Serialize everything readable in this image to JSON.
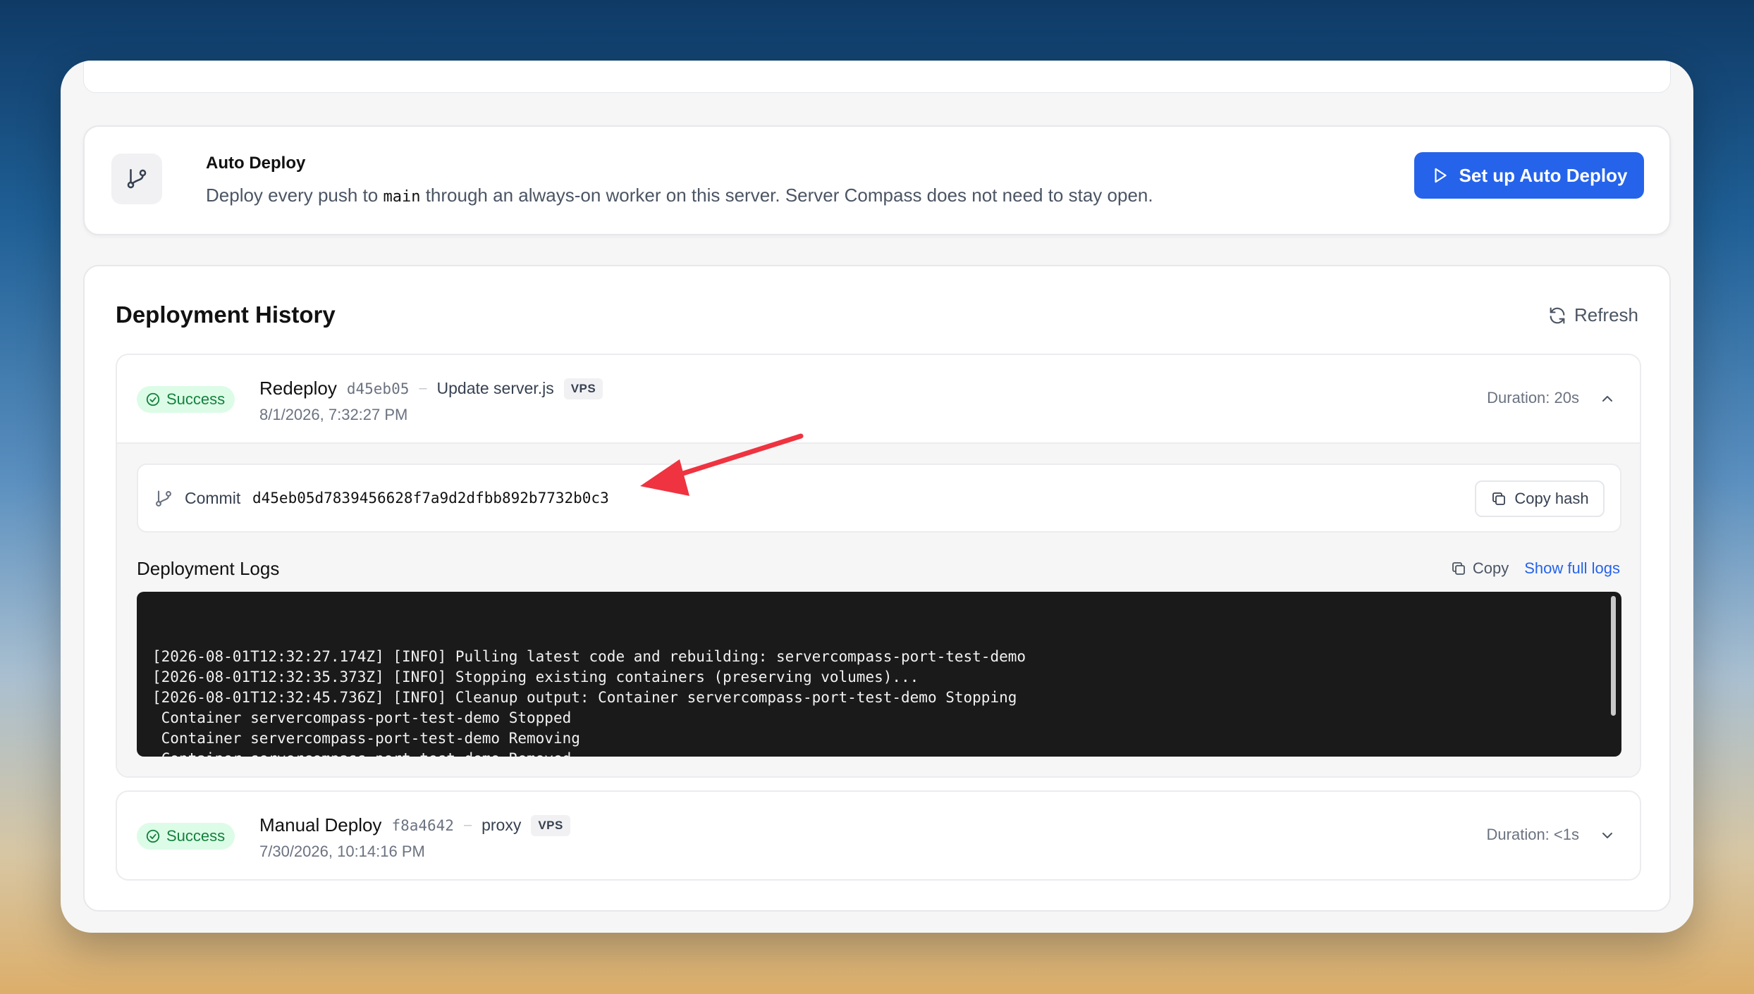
{
  "auto_deploy": {
    "title": "Auto Deploy",
    "desc_prefix": "Deploy every push to",
    "branch": "main",
    "desc_suffix": "through an always-on worker on this server. Server Compass does not need to stay open.",
    "button_label": "Set up Auto Deploy"
  },
  "history": {
    "title": "Deployment History",
    "refresh_label": "Refresh"
  },
  "deployments": [
    {
      "status": "Success",
      "type": "Redeploy",
      "hash": "d45eb05",
      "separator": "–",
      "message": "Update server.js",
      "target": "VPS",
      "date": "8/1/2026, 7:32:27 PM",
      "duration": "Duration: 20s",
      "expanded": true,
      "commit_label": "Commit",
      "commit_hash": "d45eb05d7839456628f7a9d2dfbb892b7732b0c3",
      "copy_hash_label": "Copy hash",
      "logs_title": "Deployment Logs",
      "logs_copy_label": "Copy",
      "logs_full_label": "Show full logs",
      "logs": "[2026-08-01T12:32:27.174Z] [INFO] Pulling latest code and rebuilding: servercompass-port-test-demo\n[2026-08-01T12:32:35.373Z] [INFO] Stopping existing containers (preserving volumes)...\n[2026-08-01T12:32:45.736Z] [INFO] Cleanup output: Container servercompass-port-test-demo Stopping\n Container servercompass-port-test-demo Stopped\n Container servercompass-port-test-demo Removing\n Container servercompass-port-test-demo Removed\n Network servercompass-port-test-demo_default Removing\n Network servercompass-port-test-demo_default Removed"
    },
    {
      "status": "Success",
      "type": "Manual Deploy",
      "hash": "f8a4642",
      "separator": "–",
      "message": "proxy",
      "target": "VPS",
      "date": "7/30/2026, 10:14:16 PM",
      "duration": "Duration: <1s",
      "expanded": false
    }
  ],
  "colors": {
    "accent": "#2563eb",
    "success_bg": "#dcfce7",
    "success_text": "#15803d",
    "terminal_bg": "#1a1a1a",
    "annotation_arrow": "#ef3340"
  },
  "icons": {
    "auto_deploy": "git-branch-icon",
    "button": "play-icon",
    "refresh": "refresh-icon",
    "status": "check-circle-icon",
    "collapse": "chevron-up-icon",
    "expand": "chevron-down-icon",
    "commit": "git-branch-icon",
    "copy": "copy-icon"
  }
}
